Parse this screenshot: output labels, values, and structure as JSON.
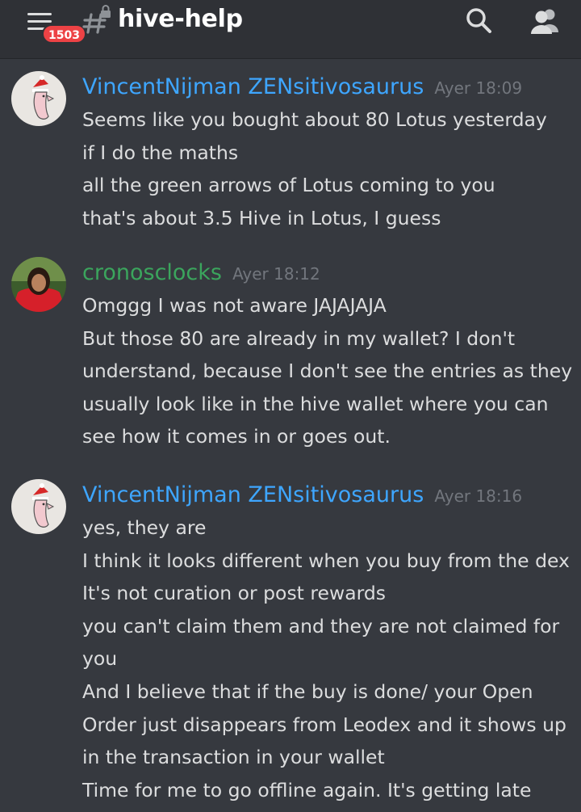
{
  "header": {
    "channel": "hive-help",
    "unread_count": "1503",
    "icons": [
      "hamburger-menu-icon",
      "locked-hashtag-icon",
      "search-icon",
      "members-icon"
    ]
  },
  "colors": {
    "background": "#36393f",
    "topbar": "#2f3136",
    "author_blue": "#3ea6ff",
    "author_green": "#3ba55d",
    "badge": "#ed4245"
  },
  "messages": [
    {
      "author": "VincentNijman ZENsitivosaurus",
      "author_color": "#3ea6ff",
      "timestamp": "Ayer 18:09",
      "lines": [
        "Seems like you bought about 80 Lotus yesterday",
        "if I do the maths",
        "all the green arrows of Lotus coming to you",
        "that's about 3.5 Hive in Lotus, I guess"
      ]
    },
    {
      "author": "cronosclocks",
      "author_color": "#3ba55d",
      "timestamp": "Ayer 18:12",
      "lines": [
        "Omggg I was not aware JAJAJAJA",
        "But those 80 are already in my wallet? I don't",
        "understand, because I don't see the entries as they",
        "usually look like in the hive wallet where you can",
        "see how it comes in or goes out."
      ]
    },
    {
      "author": "VincentNijman ZENsitivosaurus",
      "author_color": "#3ea6ff",
      "timestamp": "Ayer 18:16",
      "lines": [
        "yes, they are",
        "I think it looks different when you buy from the dex",
        "It's not curation or post rewards",
        "you can't claim them and they are not claimed for",
        "you",
        "And I believe that if the buy is done/ your Open",
        "Order just disappears from Leodex and it shows up",
        "in the transaction in your wallet",
        "Time for me to go offline again. It's getting late"
      ]
    }
  ]
}
